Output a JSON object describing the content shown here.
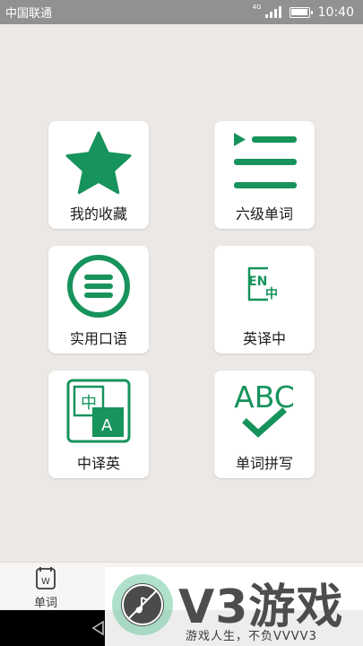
{
  "status_bar": {
    "carrier": "中国联通",
    "network": "4G",
    "time": "10:40"
  },
  "menu": {
    "items": [
      {
        "label": "我的收藏",
        "icon": "star-icon"
      },
      {
        "label": "六级单词",
        "icon": "playlist-icon"
      },
      {
        "label": "实用口语",
        "icon": "menu-circle-icon"
      },
      {
        "label": "英译中",
        "icon": "en-to-zh-icon"
      },
      {
        "label": "中译英",
        "icon": "zh-to-en-icon"
      },
      {
        "label": "单词拼写",
        "icon": "abc-check-icon"
      }
    ],
    "icon_text": {
      "en": "EN",
      "zh": "中",
      "a": "A",
      "abc": "ABC"
    }
  },
  "bottom_nav": {
    "items": [
      {
        "label": "单词",
        "icon": "vocabulary-book-icon",
        "icon_letter": "W"
      }
    ]
  },
  "watermark": {
    "logo_text": "V3游戏",
    "slogan": "游戏人生，不负VVVV3"
  },
  "colors": {
    "accent": "#17935c",
    "background": "#ebe8e5",
    "status_bar": "#929090"
  }
}
